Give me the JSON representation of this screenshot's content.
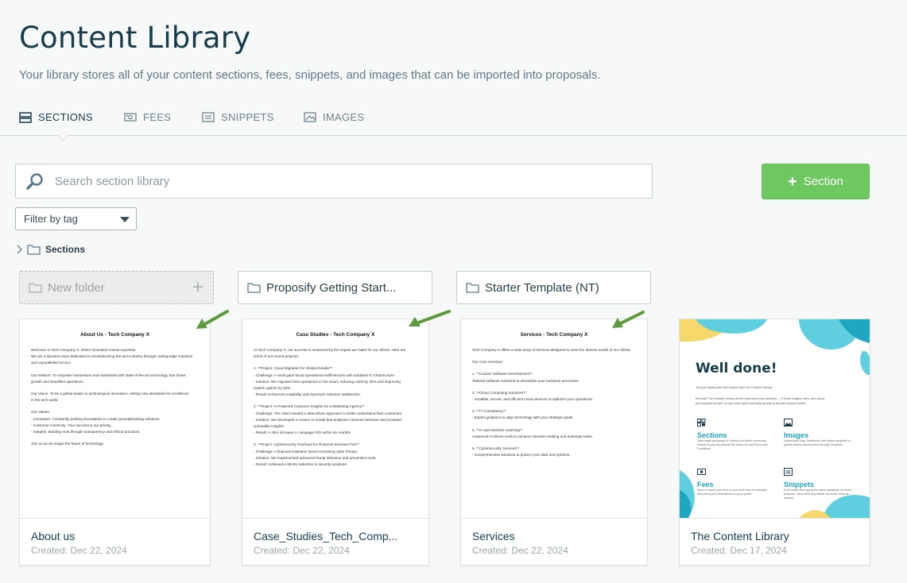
{
  "header": {
    "title": "Content Library",
    "subtitle": "Your library stores all of your content sections, fees, snippets, and images that can be imported into proposals."
  },
  "tabs": [
    {
      "label": "SECTIONS",
      "icon": "sections-icon",
      "active": true
    },
    {
      "label": "FEES",
      "icon": "fees-icon",
      "active": false
    },
    {
      "label": "SNIPPETS",
      "icon": "snippets-icon",
      "active": false
    },
    {
      "label": "IMAGES",
      "icon": "images-icon",
      "active": false
    }
  ],
  "search": {
    "placeholder": "Search section library",
    "value": ""
  },
  "add_button": {
    "label": "Section"
  },
  "filter": {
    "label": "Filter by tag"
  },
  "tree": {
    "label": "Sections"
  },
  "folders": [
    {
      "label": "New folder"
    },
    {
      "label": "Proposify Getting Start..."
    },
    {
      "label": "Starter Template (NT)"
    }
  ],
  "cards": [
    {
      "name": "About us",
      "created": "Created: Dec 22, 2024",
      "doc_title": "About Us - Tech Company X",
      "doc_lines": [
        "Welcome to Tech Company X, where innovation meets expertise.",
        "We are a dynamic team dedicated to revolutionizing the tech industry through cutting-edge solutions",
        "and unparalleled service.",
        "",
        "Our Mission: To empower businesses and individuals with state-of-the-art technology that drives",
        "growth and simplifies operations.",
        "",
        "Our Vision: To be a global leader in technological innovation, setting new standards for excellence",
        "in the tech world.",
        "",
        "Our Values:",
        "- Innovation: Constantly pushing boundaries to create groundbreaking solutions.",
        "- Customer-Centricity: Your success is our priority.",
        "- Integrity: Building trust through transparency and ethical practices.",
        "",
        "Join us as we shape the future of technology."
      ]
    },
    {
      "name": "Case_Studies_Tech_Comp...",
      "created": "Created: Dec 22, 2024",
      "doc_title": "Case Studies - Tech Company X",
      "doc_lines": [
        "At Tech Company X, our success is measured by the impact we make for our clients. Here are",
        "some of our recent projects:",
        "",
        "1. **Project: Cloud Migration for Global Retailer**",
        "   - Challenge: A retail giant faced operational inefficiencies with outdated IT infrastructure.",
        "   - Solution: We migrated their operations to the cloud, reducing costs by 30% and improving",
        "system uptime by 50%.",
        "   - Result: Enhanced scalability and improved customer satisfaction.",
        "",
        "2. **Project: AI-Powered Customer Insights for a Marketing Agency**",
        "   - Challenge: The client needed a data-driven approach to better understand their customers.",
        "   - Solution: We developed a custom AI model that analyzed customer behavior and provided",
        "actionable insights.",
        "   - Result: A 25% increase in campaign ROI within six months.",
        "",
        "3. **Project: Cybersecurity Overhaul for Financial Services Firm**",
        "   - Challenge: A financial institution faced increasing cyber threats.",
        "   - Solution: We implemented advanced threat detection and prevention tools.",
        "   - Result: Achieved a 99.9% reduction in security incidents."
      ]
    },
    {
      "name": "Services",
      "created": "Created: Dec 22, 2024",
      "doc_title": "Services - Tech Company X",
      "doc_lines": [
        "Tech Company X offers a wide array of services designed to meet the diverse needs of our clients.",
        "",
        "Our Core Services:",
        "",
        "1. **Custom Software Development**",
        "   Tailored software solutions to streamline your business processes.",
        "",
        "2. **Cloud Computing Solutions**",
        "   - Scalable, secure, and efficient cloud services to optimize your operations.",
        "",
        "3. **IT Consultancy**",
        "   - Expert guidance to align technology with your strategic goals.",
        "",
        "4. **AI and Machine Learning**",
        "   Advanced AI-driven tools to enhance decision-making and automate tasks.",
        "",
        "5. **Cybersecurity Services**",
        "   - Comprehensive solutions to protect your data and systems."
      ]
    },
    {
      "name": "The Content Library",
      "created": "Created: Dec 17, 2024",
      "preview": {
        "headline": "Well done!",
        "intro_1": "You just added your first section from the Content Library!",
        "intro_2": "But wait! The Content Library doesn't just store your sections — it holds images, fees, and saved",
        "intro_3": "text snippets as well, so you have quick and easy access to all your content needs.",
        "features": [
          {
            "label": "Sections",
            "icon": "sections-icon",
            "desc": "Save larger groupings of content you would commonly include in your documents like About Us and Terms and Conditions."
          },
          {
            "label": "Images",
            "icon": "images-icon",
            "desc": "Upload your logo, headshots and custom graphics or quickly access stock photos through Unsplash."
          },
          {
            "label": "Fees",
            "icon": "fees-icon",
            "desc": "Save or import your fees so you don't have to manually add pricing and descriptions to your quotes."
          },
          {
            "label": "Snippets",
            "icon": "snippets-icon",
            "desc": "Don't waste time typing the same paragraph for every proposal. Save these tiny tidbits and reuse them as needed."
          }
        ]
      }
    }
  ],
  "colors": {
    "accent_green": "#6dc860",
    "annotation_arrow": "#5c9a3c",
    "title": "#173c4a",
    "teal": "#1fa6c0"
  }
}
